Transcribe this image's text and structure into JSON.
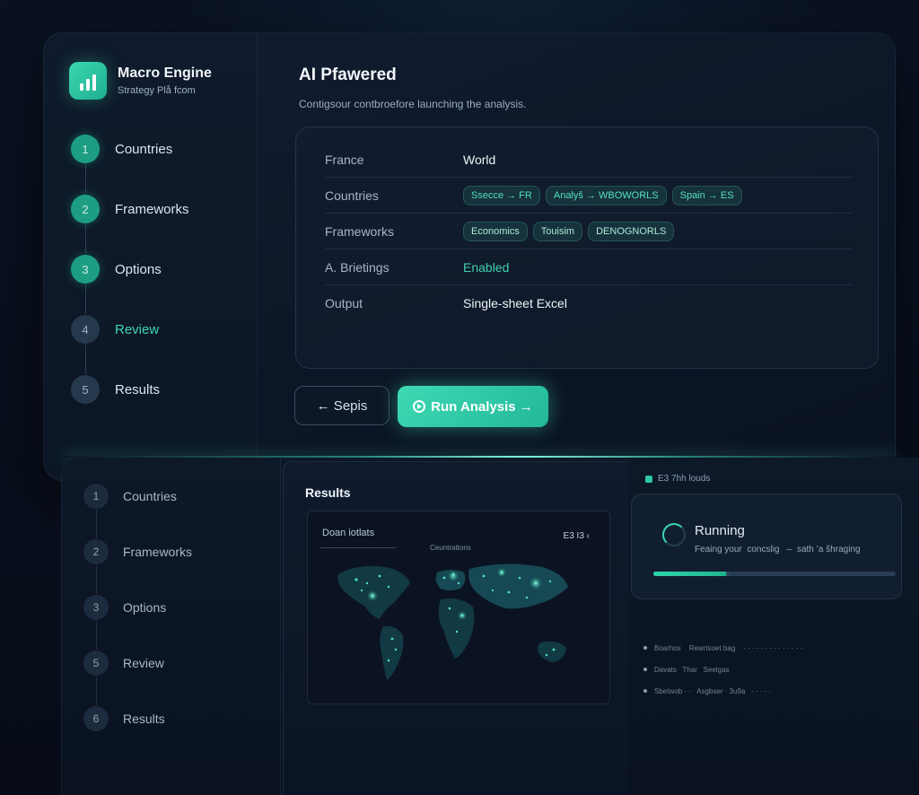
{
  "brand": {
    "title": "Macro Engine",
    "subtitle": "Strategy Plå fcom"
  },
  "steps_top": [
    {
      "number": "1",
      "label": "Countries"
    },
    {
      "number": "2",
      "label": "Frameworks"
    },
    {
      "number": "3",
      "label": "Options"
    },
    {
      "number": "4",
      "label": "Review"
    },
    {
      "number": "5",
      "label": "Results"
    }
  ],
  "main": {
    "title": "AI Pfawered",
    "subtitle": "Contigsour contbroefore launching the analysis."
  },
  "review": {
    "rows": [
      {
        "key": "France",
        "value": "World"
      },
      {
        "key": "Countries",
        "chips": [
          "Ssecce → FR",
          "Analyš → WBOWORLS",
          "Spain → ES"
        ]
      },
      {
        "key": "Frameworks",
        "chips": [
          "Economics",
          "Touisim",
          "DENOGNORLS"
        ]
      },
      {
        "key": "A. Brietings",
        "value": "Enabled"
      },
      {
        "key": "Output",
        "value": "Single-sheet Excel"
      }
    ]
  },
  "buttons": {
    "back": "← Sepis",
    "run": "Run Analysis →"
  },
  "steps_bottom": [
    {
      "number": "1",
      "label": "Countries"
    },
    {
      "number": "2",
      "label": "Frameworks"
    },
    {
      "number": "3",
      "label": "Options"
    },
    {
      "number": "5",
      "label": "Review"
    },
    {
      "number": "6",
      "label": "Results"
    }
  ],
  "results": {
    "title": "Results",
    "map_header": "Doan iotlats",
    "map_tab": "Ceuntrattons",
    "map_tag": "E3 I3 ‹"
  },
  "status": {
    "tag": "E3 7hh louds",
    "running_title": "Running",
    "running_sub": "Feaing your  concslig   –  sath ’a šhraging",
    "progress": 0.3
  },
  "logs": [
    "Boarhos    Rewrtsoet bag    · · · · · · · · · · · · · ·",
    "Davats   Thar   Seelgas",
    "Sbetwob · ·   Asgbser · 3u9a   · · · · ·"
  ],
  "colors": {
    "accent": "#3fd9b4",
    "background": "#070d1b",
    "panel": "#111d30"
  }
}
